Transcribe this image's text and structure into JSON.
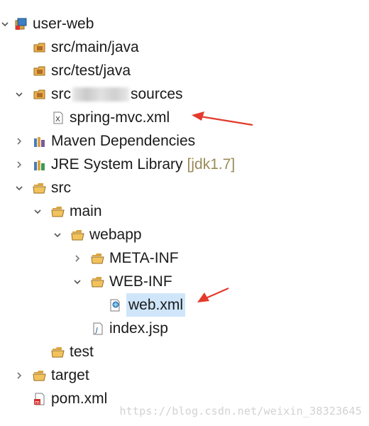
{
  "tree": {
    "root": "user-web",
    "src_main_java": "src/main/java",
    "src_test_java": "src/test/java",
    "resources_prefix": "src",
    "resources_suffix": "sources",
    "spring_mvc": "spring-mvc.xml",
    "maven_deps": "Maven Dependencies",
    "jre_lib": "JRE System Library",
    "jre_decor": "[jdk1.7]",
    "src": "src",
    "main": "main",
    "webapp": "webapp",
    "meta_inf": "META-INF",
    "web_inf": "WEB-INF",
    "web_xml": "web.xml",
    "index_jsp": "index.jsp",
    "test": "test",
    "target": "target",
    "pom": "pom.xml"
  },
  "watermark": "https://blog.csdn.net/weixin_38323645",
  "colors": {
    "selection": "#cfe6fa",
    "arrow": "#e33a2c",
    "folder": "#e8b04a"
  }
}
